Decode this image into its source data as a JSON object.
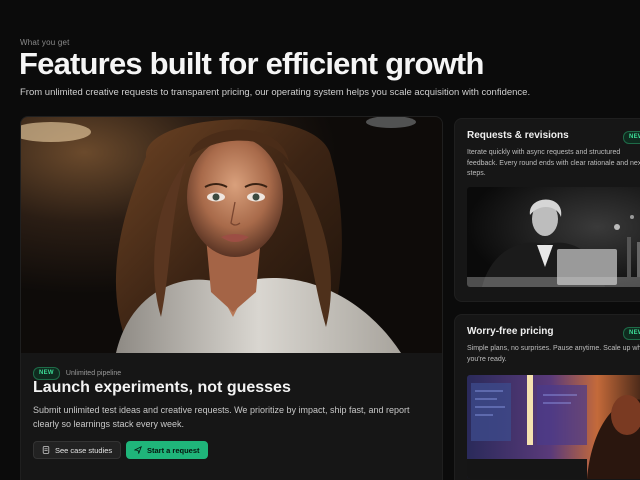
{
  "header": {
    "eyebrow": "What you get",
    "title": "Features built for efficient growth",
    "subtitle": "From unlimited creative requests to transparent pricing, our operating system helps you scale acquisition with confidence."
  },
  "main_card": {
    "badge": "NEW",
    "badge_caption": "Unlimited pipeline",
    "title": "Launch experiments, not guesses",
    "description": "Submit unlimited test ideas and creative requests. We prioritize by impact, ship fast, and report clearly so learnings stack every week.",
    "secondary_button": "See case studies",
    "primary_button": "Start a request"
  },
  "side_cards": [
    {
      "title": "Requests & revisions",
      "badge": "NEW",
      "description": "Iterate quickly with async requests and structured feedback. Every round ends with clear rationale and next steps."
    },
    {
      "title": "Worry-free pricing",
      "badge": "NEW",
      "description": "Simple plans, no surprises. Pause anytime. Scale up when you're ready."
    }
  ],
  "colors": {
    "background": "#0b0b0b",
    "card": "#161616",
    "accent": "#1fb57a",
    "badge_text": "#3ddc97"
  },
  "icons": {
    "secondary_button": "document-icon",
    "primary_button": "send-icon"
  }
}
